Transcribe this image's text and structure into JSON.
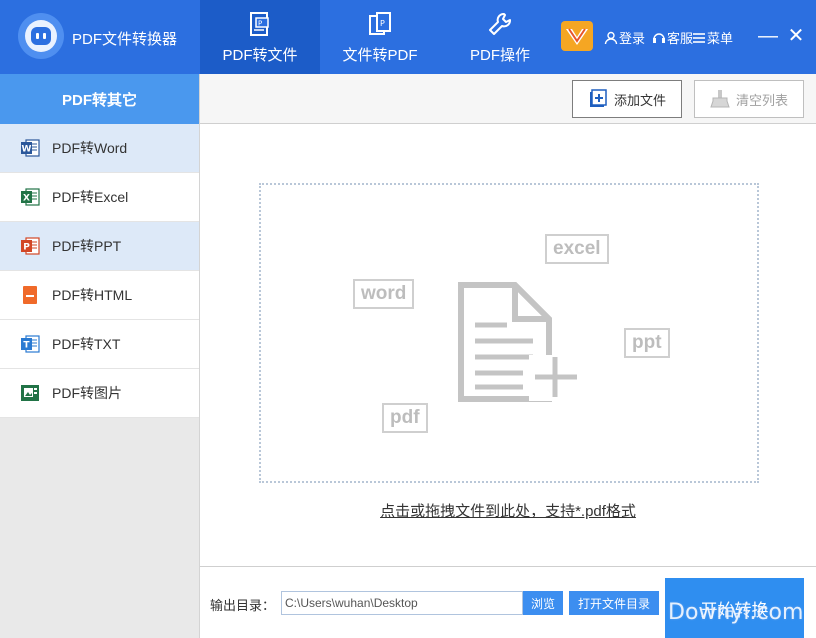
{
  "app": {
    "title": "PDF文件转换器"
  },
  "nav": {
    "tabs": [
      {
        "label": "PDF转文件",
        "icon": "pdf-to-file-icon",
        "active": true
      },
      {
        "label": "文件转PDF",
        "icon": "file-to-pdf-icon",
        "active": false
      },
      {
        "label": "PDF操作",
        "icon": "wrench-icon",
        "active": false
      }
    ]
  },
  "header": {
    "login_label": "登录",
    "service_label": "客服",
    "menu_label": "菜单",
    "minimize_label": "—",
    "close_label": "✕"
  },
  "sidebar": {
    "heading": "PDF转其它",
    "items": [
      {
        "label": "PDF转Word",
        "icon": "word-icon",
        "color": "#2b579a",
        "letter": "W",
        "active": true
      },
      {
        "label": "PDF转Excel",
        "icon": "excel-icon",
        "color": "#217346",
        "letter": "X",
        "active": false
      },
      {
        "label": "PDF转PPT",
        "icon": "ppt-icon",
        "color": "#d24726",
        "letter": "P",
        "active": true
      },
      {
        "label": "PDF转HTML",
        "icon": "html-icon",
        "color": "#f06a2a",
        "letter": "",
        "active": false
      },
      {
        "label": "PDF转TXT",
        "icon": "txt-icon",
        "color": "#2a7ad2",
        "letter": "T",
        "active": false
      },
      {
        "label": "PDF转图片",
        "icon": "image-icon",
        "color": "#217346",
        "letter": "",
        "active": false
      }
    ]
  },
  "toolbar": {
    "add_label": "添加文件",
    "clear_label": "清空列表"
  },
  "dropzone": {
    "tags": [
      "word",
      "excel",
      "ppt",
      "pdf"
    ],
    "hint": "点击或拖拽文件到此处，支持*.pdf格式"
  },
  "output": {
    "label": "输出目录：",
    "path": "C:\\Users\\wuhan\\Desktop",
    "browse_label": "浏览",
    "open_label": "打开文件目录",
    "start_label": "开始转换"
  },
  "watermark": "Downyi.com",
  "colors": {
    "primary": "#2c6fe0",
    "accent": "#2f8ef0",
    "sidebar_head": "#4a98ee",
    "active_row": "#dde9f8"
  }
}
